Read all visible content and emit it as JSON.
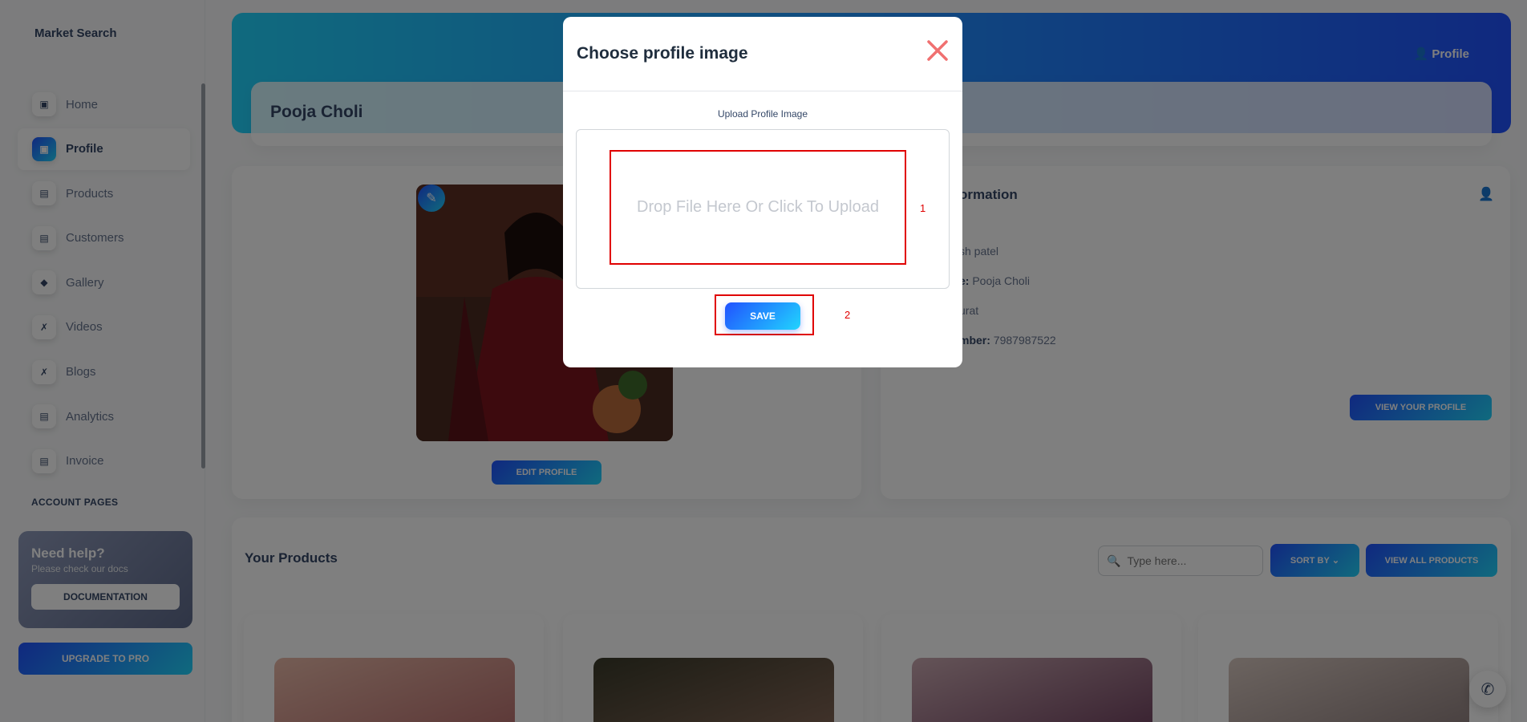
{
  "sidebar": {
    "brand": "Market Search",
    "items": [
      {
        "label": "Home",
        "icon": "home-icon"
      },
      {
        "label": "Profile",
        "icon": "profile-icon"
      },
      {
        "label": "Products",
        "icon": "products-icon"
      },
      {
        "label": "Customers",
        "icon": "customers-icon"
      },
      {
        "label": "Gallery",
        "icon": "gallery-icon"
      },
      {
        "label": "Videos",
        "icon": "videos-icon"
      },
      {
        "label": "Blogs",
        "icon": "blogs-icon"
      },
      {
        "label": "Analytics",
        "icon": "analytics-icon"
      },
      {
        "label": "Invoice",
        "icon": "invoice-icon"
      }
    ],
    "section_title": "ACCOUNT PAGES",
    "help": {
      "title": "Need help?",
      "subtitle": "Please check our docs",
      "button": "DOCUMENTATION"
    },
    "upgrade_button": "UPGRADE TO PRO"
  },
  "header": {
    "profile_link": "Profile",
    "name": "Pooja Choli"
  },
  "profile_card": {
    "edit_button": "EDIT PROFILE"
  },
  "info_card": {
    "title_partial": "ormation",
    "rows": [
      {
        "label": "",
        "value": "sh patel"
      },
      {
        "label": "e:",
        "value": "Pooja Choli"
      },
      {
        "label": "",
        "value": "urat"
      },
      {
        "label": "mber:",
        "value": "7987987522"
      }
    ],
    "view_button": "VIEW YOUR PROFILE"
  },
  "products": {
    "title": "Your Products",
    "search_placeholder": "Type here...",
    "sort_button": "SORT BY",
    "view_all_button": "VIEW ALL PRODUCTS"
  },
  "modal": {
    "title": "Choose profile image",
    "upload_label": "Upload Profile Image",
    "drop_text": "Drop File Here Or Click To Upload",
    "marker_1": "1",
    "marker_2": "2",
    "save_button": "SAVE"
  },
  "colors": {
    "accent_gradient_start": "#2152ff",
    "accent_gradient_end": "#21d4fd",
    "annotation_red": "#e00000",
    "close_icon": "#f07070"
  }
}
